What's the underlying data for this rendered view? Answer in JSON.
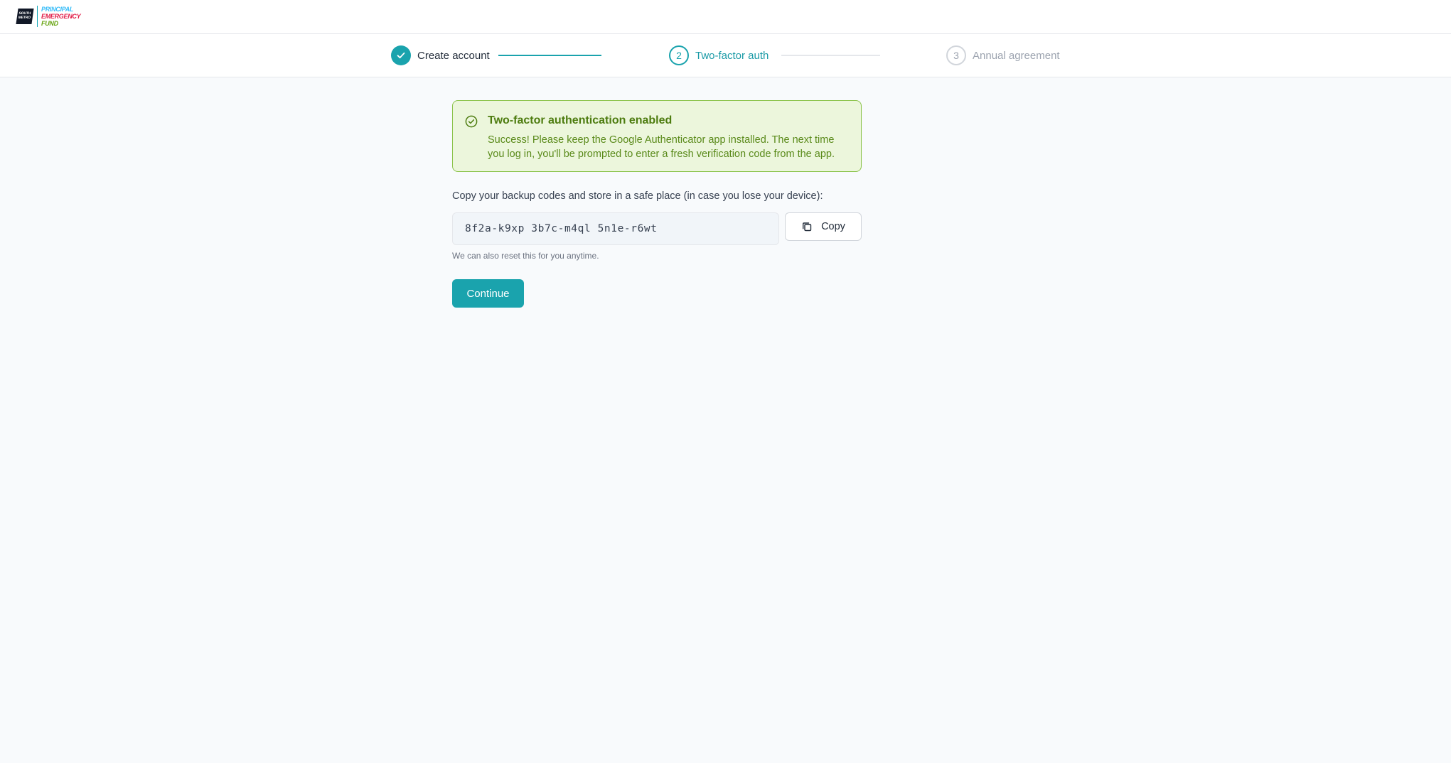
{
  "brand": {
    "mark_text": "SOUTH METRO",
    "line1": "PRINCIPAL",
    "line2": "EMERGENCY",
    "line3": "FUND",
    "colors": {
      "line1": "#38bdf8",
      "line2": "#e11d48",
      "line3": "#65a30d"
    }
  },
  "steps": [
    {
      "index": "1",
      "label": "Create account",
      "state": "complete",
      "icon": "check-icon"
    },
    {
      "index": "2",
      "label": "Two-factor auth",
      "state": "current"
    },
    {
      "index": "3",
      "label": "Annual agreement",
      "state": "upcoming"
    }
  ],
  "alert": {
    "icon": "check-circle-icon",
    "title": "Two-factor authentication enabled",
    "body": "Success! Please keep the Google Authenticator app installed. The next time you log in, you'll be prompted to enter a fresh verification code from the app."
  },
  "backup": {
    "instructions": "Copy your backup codes and store in a safe place (in case you lose your device):",
    "codes": "8f2a-k9xp 3b7c-m4ql 5n1e-r6wt",
    "copy_label": "Copy",
    "copy_icon": "copy-icon",
    "hint": "We can also reset this for you anytime."
  },
  "continue_label": "Continue",
  "colors": {
    "accent": "#1aa3ad",
    "success_bg": "#ecf6dc",
    "success_border": "#8bc34a",
    "success_text": "#4d7c0f"
  }
}
